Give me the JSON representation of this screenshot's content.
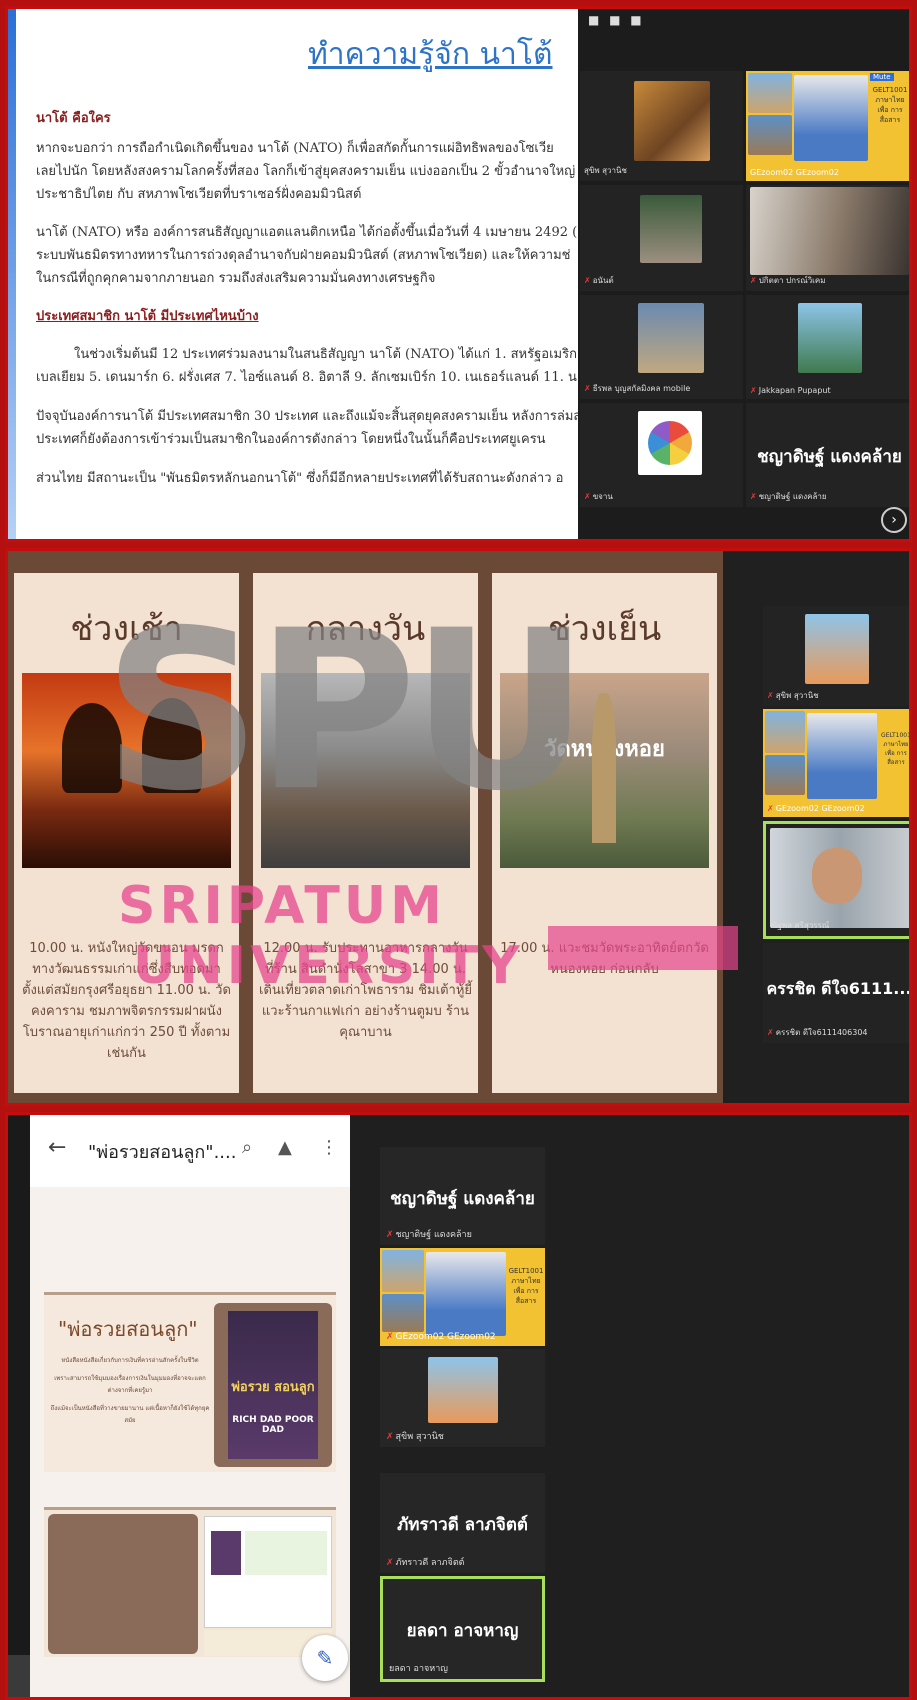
{
  "panel1": {
    "title": "ทำความรู้จัก นาโต้",
    "heading1": "นาโต้ คือใคร",
    "para1_l1": "หากจะบอกว่า การถือกำเนิดเกิดขึ้นของ นาโต้ (NATO) ก็เพื่อสกัดกั้นการแผ่อิทธิพลของโซเวีย",
    "para1_l2": "เลยไปนัก โดยหลังสงครามโลกครั้งที่สอง โลกก็เข้าสู่ยุคสงครามเย็น แบ่งออกเป็น 2 ขั้วอำนาจใหญ่",
    "para1_l3": "ประชาธิปไตย กับ สหภาพโซเวียตที่บราเซอร์ฝั่งคอมมิวนิสต์",
    "para2_l1": "นาโต้ (NATO) หรือ องค์การสนธิสัญญาแอตแลนติกเหนือ ได้ก่อตั้งขึ้นเมื่อวันที่ 4 เมษายน 2492 (ค.",
    "para2_l2": "ระบบพันธมิตรทางทหารในการถ่วงดุลอำนาจกับฝ่ายคอมมิวนิสต์ (สหภาพโซเวียต) และให้ความช่",
    "para2_l3": "ในกรณีที่ถูกคุกคามจากภายนอก รวมถึงส่งเสริมความมั่นคงทางเศรษฐกิจ",
    "heading2": "ประเทศสมาชิก นาโต้ มีประเทศไหนบ้าง",
    "para3_l1": "ในช่วงเริ่มต้นมี 12 ประเทศร่วมลงนามในสนธิสัญญา นาโต้ (NATO) ได้แก่ 1. สหรัฐอเมริกา",
    "para3_l2": "เบลเยียม 5. เดนมาร์ก 6. ฝรั่งเศส 7. ไอซ์แลนด์ 8. อิตาลี 9. ลักเซมเบิร์ก 10. เนเธอร์แลนด์ 11. นอร์เว",
    "para4_l1": "ปัจจุบันองค์การนาโต้ มีประเทศสมาชิก 30 ประเทศ และถึงแม้จะสิ้นสุดยุคสงครามเย็น หลังการล่มส",
    "para4_l2": "ประเทศก็ยังต้องการเข้าร่วมเป็นสมาชิกในองค์การดังกล่าว โดยหนึ่งในนั้นก็คือประเทศยูเครน",
    "para5_l1": "ส่วนไทย มีสถานะเป็น \"พันธมิตรหลักนอกนาโต้\" ซึ่งก็มีอีกหลายประเทศที่ได้รับสถานะดังกล่าว อ",
    "tiles": [
      {
        "name": "สุขิพ สุวานิช"
      },
      {
        "name": "GEzoom02 GEzoom02",
        "sign": "GELT1001 ภาษาไทย เพื่อ การสื่อสาร",
        "mute": "Mute"
      },
      {
        "name": "อนันต์"
      },
      {
        "name": "ปกิตตา ปกรณ์วิเคม"
      },
      {
        "name": "ธีรพล บุญสกัลมิงคล mobile"
      },
      {
        "name": "Jakkapan Pupaput"
      },
      {
        "name": "ขจาน"
      },
      {
        "name": "ชญาดิษฐ์ แดงคล้าย",
        "big": "ชญาดิษฐ์ แดงคล้าย"
      }
    ],
    "next": "›"
  },
  "panel2": {
    "cards": [
      {
        "title": "ช่วงเช้า",
        "text": "10.00 น. หนังใหญ่วัดขนอน มรดกทางวัฒนธรรมเก่าแก่ซึ่งสืบทอดมาตั้งแต่สมัยกรุงศรีอยุธยา 11.00 น. วัดคงคาราม ชมภาพจิตรกรรมฝาผนังโบราณอายุเก่าแก่กว่า 250 ปี ทั้งตามเช่นกัน",
        "badge": ""
      },
      {
        "title": "กลางวัน",
        "text": "12.00 น. รับประทานอาหารกลางวัน ที่ร้าน สินดำนั่งโลสาขา 3 14.00 น. เดินเที่ยวตลาดเก่าโพธาราม ชิมเต้าหู้ยี้ แวะร้านกาแฟเก่า อย่างร้านตูมบ ร้านคุณาบาน",
        "badge": ""
      },
      {
        "title": "ช่วงเย็น",
        "text": "17.00 น. แวะชมวัดพระอาทิตย์ตกวัดหนองหอย ก่อนกลับ",
        "badge": "วัดหนองหอย"
      }
    ],
    "watermark_big": "SPU",
    "watermark_line1": "SRIPATUM",
    "watermark_line2": "UNIVERSITY",
    "tiles": [
      {
        "name": "สุขิพ สุวานิช"
      },
      {
        "name": "GEzoom02 GEzoom02",
        "sign": "GELT1001 ภาษาไทย เพื่อ การสื่อสาร"
      },
      {
        "name": "ณัฐพล ศรีสุวรรณ์"
      },
      {
        "name": "ครรชิต ดีใจ6111406304",
        "big": "ครรชิต ดีใจ6111..."
      }
    ]
  },
  "panel3": {
    "doc_title": "\"พ่อรวยสอนลูก\"....",
    "page1_title": "\"พ่อรวยสอนลูก\"",
    "page1_sub1": "หนังสือหนังสือเกี่ยวกับการเงินที่ควรอ่านสักครั้งในชีวิต",
    "page1_sub2": "เพราะสามารถใช้มุมมองเรื่องการเงินในมุมมองที่อาจจะแตกต่างจากที่เคยรู้มา",
    "page1_sub3": "ถึงแม้จะเป็นหนังสือที่วางขายมานาน แต่เนื้อหาก็ยังใช้ได้ทุกยุคสมัย",
    "book_title": "พ่อรวย สอนลูก",
    "book_sub": "RICH DAD POOR DAD",
    "tiles": [
      {
        "name": "ชญาดิษฐ์ แดงคล้าย",
        "big": "ชญาดิษฐ์ แดงคล้าย"
      },
      {
        "name": "GEzoom02 GEzoom02",
        "sign": "GELT1001 ภาษาไทย เพื่อ การสื่อสาร"
      },
      {
        "name": "สุขิพ สุวานิช"
      },
      {
        "name": "ภัทราวดี ลาภจิตต์",
        "big": "ภัทราวดี ลาภจิตต์"
      },
      {
        "name": "ยลดา อาจหาญ",
        "big": "ยลดา อาจหาญ"
      }
    ]
  },
  "colors": {
    "frame": "#c40d0d",
    "zoom_bg": "#1c1c1c",
    "active_speaker": "#a6e05a"
  }
}
